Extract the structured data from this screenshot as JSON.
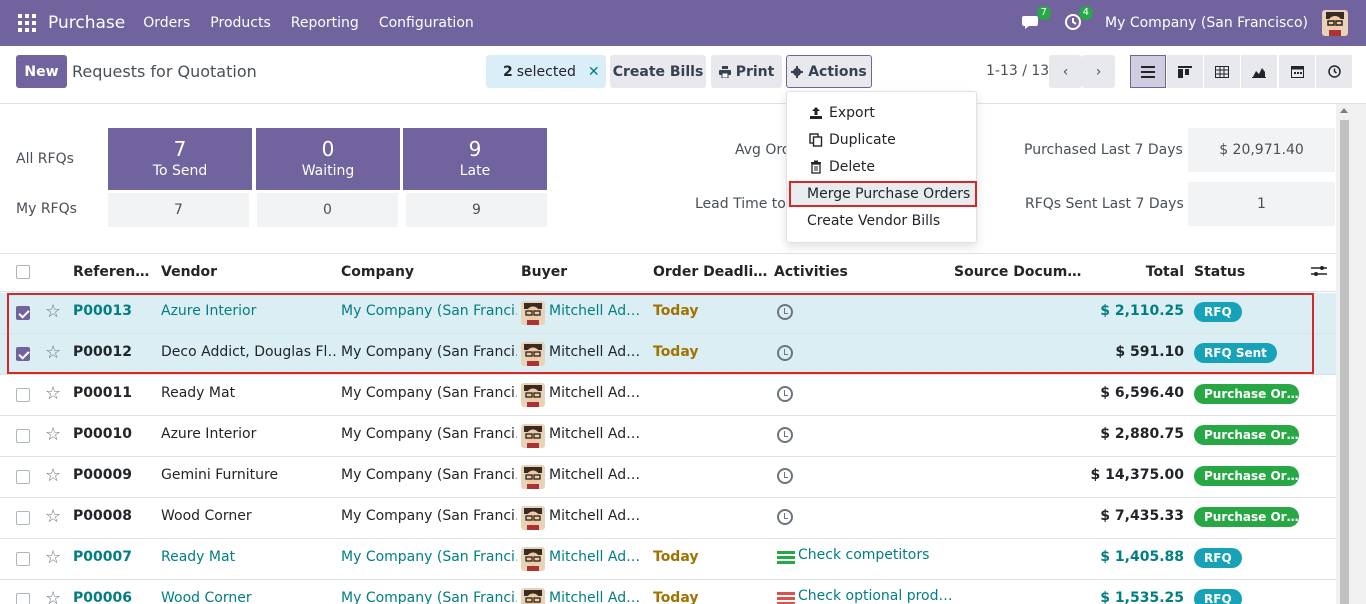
{
  "navbar": {
    "brand": "Purchase",
    "menu": [
      "Orders",
      "Products",
      "Reporting",
      "Configuration"
    ],
    "messages_count": "7",
    "activities_count": "4",
    "company": "My Company (San Francisco)"
  },
  "control_panel": {
    "new_label": "New",
    "title": "Requests for Quotation",
    "selected_count": "2",
    "selected_label": "selected",
    "create_bills_label": "Create Bills",
    "print_label": "Print",
    "actions_label": "Actions",
    "pager": "1-13 / 13"
  },
  "actions_menu": {
    "items": [
      "Export",
      "Duplicate",
      "Delete",
      "Merge Purchase Orders",
      "Create Vendor Bills"
    ],
    "highlighted": "Merge Purchase Orders"
  },
  "dashboard": {
    "all_rfqs_label": "All RFQs",
    "my_rfqs_label": "My RFQs",
    "tiles": [
      {
        "num": "7",
        "label": "To Send",
        "mine": "7"
      },
      {
        "num": "0",
        "label": "Waiting",
        "mine": "0"
      },
      {
        "num": "9",
        "label": "Late",
        "mine": "9"
      }
    ],
    "avg_order_label": "Avg Ord",
    "lead_time_label": "Lead Time to P",
    "purchased_label": "Purchased Last 7 Days",
    "purchased_value": "$ 20,971.40",
    "rfqs_sent_label": "RFQs Sent Last 7 Days",
    "rfqs_sent_value": "1"
  },
  "table": {
    "headers": {
      "reference": "Referen…",
      "vendor": "Vendor",
      "company": "Company",
      "buyer": "Buyer",
      "deadline": "Order Deadli…",
      "activities": "Activities",
      "source": "Source Docum…",
      "total": "Total",
      "status": "Status"
    },
    "rows": [
      {
        "ref": "P00013",
        "vendor": "Azure Interior",
        "company": "My Company (San Franci…",
        "buyer": "Mitchell Ad…",
        "deadline": "Today",
        "activity": "",
        "total": "$ 2,110.25",
        "status": "RFQ",
        "selected": true,
        "link": true
      },
      {
        "ref": "P00012",
        "vendor": "Deco Addict, Douglas Fl…",
        "company": "My Company (San Franci…",
        "buyer": "Mitchell Ad…",
        "deadline": "Today",
        "activity": "",
        "total": "$ 591.10",
        "status": "RFQ Sent",
        "selected": true,
        "link": false
      },
      {
        "ref": "P00011",
        "vendor": "Ready Mat",
        "company": "My Company (San Franci…",
        "buyer": "Mitchell Ad…",
        "deadline": "",
        "activity": "",
        "total": "$ 6,596.40",
        "status": "Purchase Or…",
        "selected": false,
        "link": false
      },
      {
        "ref": "P00010",
        "vendor": "Azure Interior",
        "company": "My Company (San Franci…",
        "buyer": "Mitchell Ad…",
        "deadline": "",
        "activity": "",
        "total": "$ 2,880.75",
        "status": "Purchase Or…",
        "selected": false,
        "link": false
      },
      {
        "ref": "P00009",
        "vendor": "Gemini Furniture",
        "company": "My Company (San Franci…",
        "buyer": "Mitchell Ad…",
        "deadline": "",
        "activity": "",
        "total": "$ 14,375.00",
        "status": "Purchase Or…",
        "selected": false,
        "link": false
      },
      {
        "ref": "P00008",
        "vendor": "Wood Corner",
        "company": "My Company (San Franci…",
        "buyer": "Mitchell Ad…",
        "deadline": "",
        "activity": "",
        "total": "$ 7,435.33",
        "status": "Purchase Or…",
        "selected": false,
        "link": false
      },
      {
        "ref": "P00007",
        "vendor": "Ready Mat",
        "company": "My Company (San Franci…",
        "buyer": "Mitchell Ad…",
        "deadline": "Today",
        "activity": "Check competitors",
        "total": "$ 1,405.88",
        "status": "RFQ",
        "selected": false,
        "link": true
      },
      {
        "ref": "P00006",
        "vendor": "Wood Corner",
        "company": "My Company (San Franci…",
        "buyer": "Mitchell Ad…",
        "deadline": "Today",
        "activity": "Check optional prod…",
        "total": "$ 1,535.25",
        "status": "RFQ",
        "selected": false,
        "link": true
      }
    ]
  },
  "colors": {
    "brand": "#71639e",
    "link": "#017e84",
    "rfq_badge": "#17a2b8",
    "po_badge": "#28a745",
    "today": "#a07200",
    "highlight": "#d62828"
  }
}
